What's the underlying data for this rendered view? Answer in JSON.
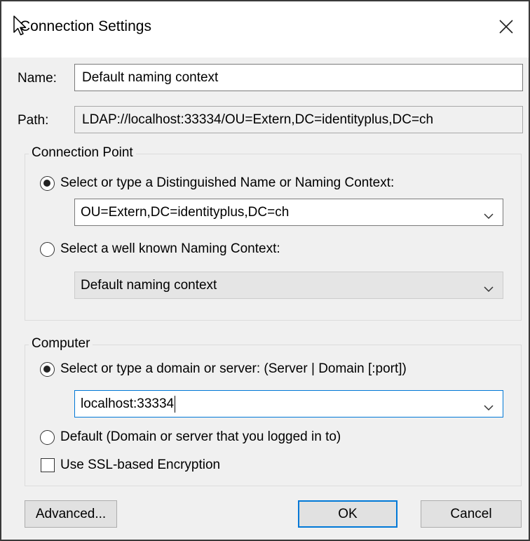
{
  "window": {
    "title": "Connection Settings"
  },
  "name": {
    "label": "Name:",
    "value": "Default naming context"
  },
  "path": {
    "label": "Path:",
    "value": "LDAP://localhost:33334/OU=Extern,DC=identityplus,DC=ch"
  },
  "connection_point": {
    "label": "Connection Point",
    "option_dn": {
      "label": "Select or type a Distinguished Name or Naming Context:",
      "checked": true
    },
    "dn_value": "OU=Extern,DC=identityplus,DC=ch",
    "option_known": {
      "label": "Select a well known Naming Context:",
      "checked": false
    },
    "known_value": "Default naming context"
  },
  "computer": {
    "label": "Computer",
    "option_server": {
      "label": "Select or type a domain or server: (Server | Domain [:port])",
      "checked": true
    },
    "server_value": "localhost:33334",
    "option_default": {
      "label": "Default (Domain or server that you logged in to)",
      "checked": false
    },
    "ssl": {
      "label": "Use SSL-based Encryption",
      "checked": false
    }
  },
  "buttons": {
    "advanced": "Advanced...",
    "ok": "OK",
    "cancel": "Cancel"
  },
  "icons": [
    "cursor-icon",
    "close-icon",
    "chevron-down-icon"
  ],
  "colors": {
    "accent": "#0078d7",
    "background": "#f0f0f0"
  }
}
